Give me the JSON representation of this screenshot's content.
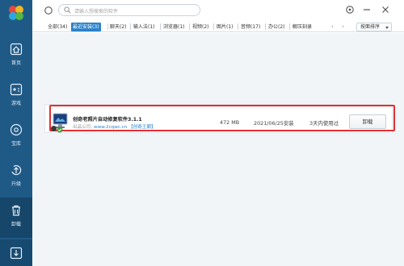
{
  "sidebar": {
    "items": [
      {
        "label": "首页",
        "icon": "home-icon"
      },
      {
        "label": "游戏",
        "icon": "gamepad-icon"
      },
      {
        "label": "宝库",
        "icon": "disc-icon"
      },
      {
        "label": "升级",
        "icon": "upgrade-icon"
      },
      {
        "label": "卸载",
        "icon": "trash-icon"
      },
      {
        "label": "",
        "icon": "download-icon"
      }
    ],
    "active_index": 4,
    "colors": {
      "bg": "#1f5a87",
      "active": "#164669"
    }
  },
  "search": {
    "placeholder": "请输入想搜索的软件"
  },
  "tabs": [
    {
      "label": "全部(34)"
    },
    {
      "label": "最近安装(3)"
    },
    {
      "label": "聊天(2)"
    },
    {
      "label": "输入法(1)"
    },
    {
      "label": "浏览器(1)"
    },
    {
      "label": "视频(2)"
    },
    {
      "label": "图片(1)"
    },
    {
      "label": "音频(17)"
    },
    {
      "label": "办公(2)"
    },
    {
      "label": "解压刻录"
    }
  ],
  "active_tab": 1,
  "pager": {
    "prev": "‹",
    "next": "›"
  },
  "sort": {
    "label": "按面排序"
  },
  "app": {
    "name": "创奇老照片自动修复软件3.1.1",
    "publisher_label": "出品公司: ",
    "publisher_url": "www.2cqwc.cn",
    "publisher_name": "【创奇王朝】",
    "size": "472 MB",
    "install_date": "2021/06/25安装",
    "last_used": "3天内使用过",
    "action": "卸载"
  },
  "colors": {
    "accent": "#2b82c9",
    "highlight": "#e12f33"
  }
}
